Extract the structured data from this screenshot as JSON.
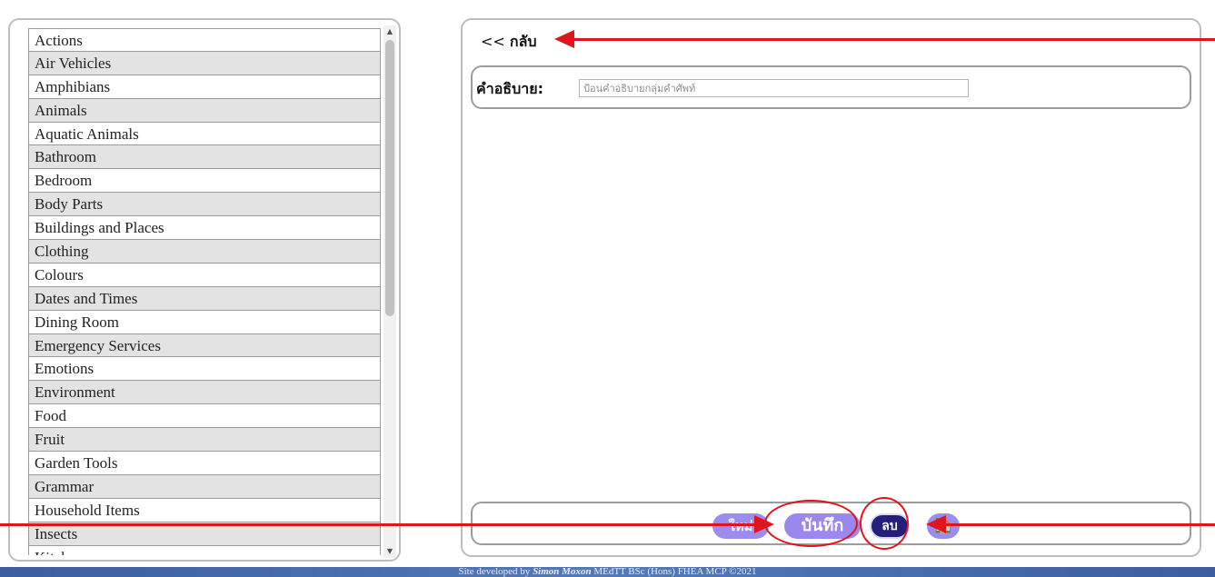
{
  "topics": [
    "Actions",
    "Air Vehicles",
    "Amphibians",
    "Animals",
    "Aquatic Animals",
    "Bathroom",
    "Bedroom",
    "Body Parts",
    "Buildings and Places",
    "Clothing",
    "Colours",
    "Dates and Times",
    "Dining Room",
    "Emergency Services",
    "Emotions",
    "Environment",
    "Food",
    "Fruit",
    "Garden Tools",
    "Grammar",
    "Household Items",
    "Insects",
    "Kitchen"
  ],
  "back": {
    "chevron": "<<",
    "label": "กลับ"
  },
  "description": {
    "label": "คำอธิบาย:",
    "placeholder": "ป้อนคำอธิบายกลุ่มคำศัพท์"
  },
  "buttons": {
    "new": "ใหม่",
    "save": "บันทึก",
    "delete": "ลบ",
    "home": "🏠"
  },
  "scrollbar": {
    "up": "▲",
    "down": "▼"
  },
  "footer": {
    "prefix": "Site developed by",
    "author": "Simon Moxon",
    "credentials": "MEdTT  BSc (Hons)  FHEA  MCP  ©2021"
  },
  "colors": {
    "annotation": "#e0141d",
    "button": "#9a88ef",
    "delete_button": "#231f7a"
  }
}
